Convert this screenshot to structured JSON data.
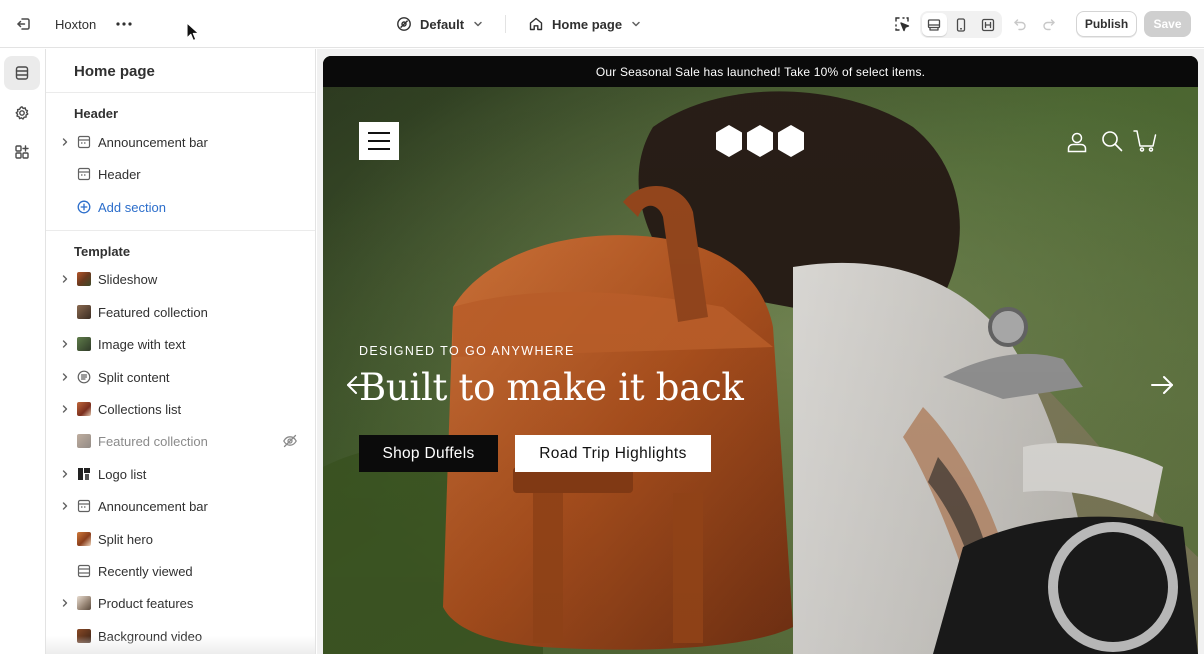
{
  "topbar": {
    "store_name": "Hoxton",
    "theme_label": "Default",
    "page_label": "Home page",
    "publish_label": "Publish",
    "save_label": "Save"
  },
  "sidebar": {
    "title": "Home page",
    "header_group_label": "Header",
    "header_items": [
      {
        "label": "Announcement bar",
        "icon": "section-icon",
        "expandable": true
      },
      {
        "label": "Header",
        "icon": "section-icon",
        "expandable": false
      }
    ],
    "add_section_label": "Add section",
    "template_group_label": "Template",
    "template_items": [
      {
        "label": "Slideshow",
        "icon": "slideshow-thumbnail",
        "expandable": true,
        "hidden": false
      },
      {
        "label": "Featured collection",
        "icon": "collection-thumbnail",
        "expandable": false,
        "hidden": false
      },
      {
        "label": "Image with text",
        "icon": "image-text-thumbnail",
        "expandable": true,
        "hidden": false
      },
      {
        "label": "Split content",
        "icon": "text-block-icon",
        "expandable": true,
        "hidden": false
      },
      {
        "label": "Collections list",
        "icon": "collections-thumbnail",
        "expandable": true,
        "hidden": false
      },
      {
        "label": "Featured collection",
        "icon": "collection-thumbnail",
        "expandable": false,
        "hidden": true
      },
      {
        "label": "Logo list",
        "icon": "logo-thumbnail",
        "expandable": true,
        "hidden": false
      },
      {
        "label": "Announcement bar",
        "icon": "section-icon",
        "expandable": true,
        "hidden": false
      },
      {
        "label": "Split hero",
        "icon": "hero-thumbnail",
        "expandable": false,
        "hidden": false
      },
      {
        "label": "Recently viewed",
        "icon": "section-icon",
        "expandable": false,
        "hidden": false
      },
      {
        "label": "Product features",
        "icon": "features-thumbnail",
        "expandable": true,
        "hidden": false
      },
      {
        "label": "Background video",
        "icon": "video-thumbnail",
        "expandable": false,
        "hidden": false
      }
    ]
  },
  "preview": {
    "announcement_text": "Our Seasonal Sale has launched! Take 10% of select items.",
    "kicker": "DESIGNED TO GO ANYWHERE",
    "headline": "Built to make it back",
    "primary_button": "Shop Duffels",
    "secondary_button": "Road Trip Highlights"
  },
  "colors": {
    "accent_link": "#2c6ecb",
    "announcement_bg": "#0a0a0a",
    "save_disabled": "#cfcfcf"
  }
}
